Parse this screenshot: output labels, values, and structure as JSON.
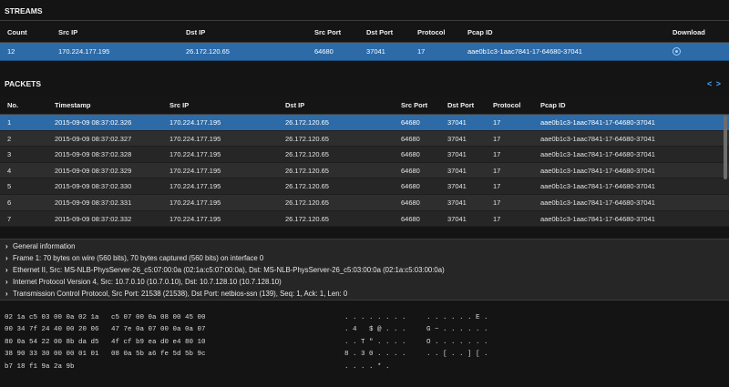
{
  "streams": {
    "title": "STREAMS",
    "headers": [
      "Count",
      "Src IP",
      "Dst IP",
      "Src Port",
      "Dst Port",
      "Protocol",
      "Pcap ID",
      "Download"
    ],
    "row": [
      "12",
      "170.224.177.195",
      "26.172.120.65",
      "64680",
      "37041",
      "17",
      "aae0b1c3-1aac7841-17-64680-37041"
    ],
    "download_icon": "download-circle-icon"
  },
  "packets": {
    "title": "PACKETS",
    "nav": "< >",
    "headers": [
      "No.",
      "Timestamp",
      "Src IP",
      "Dst IP",
      "Src Port",
      "Dst Port",
      "Protocol",
      "Pcap ID"
    ],
    "rows": [
      [
        "1",
        "2015-09-09 08:37:02.326",
        "170.224.177.195",
        "26.172.120.65",
        "64680",
        "37041",
        "17",
        "aae0b1c3-1aac7841-17-64680-37041"
      ],
      [
        "2",
        "2015-09-09 08:37:02.327",
        "170.224.177.195",
        "26.172.120.65",
        "64680",
        "37041",
        "17",
        "aae0b1c3-1aac7841-17-64680-37041"
      ],
      [
        "3",
        "2015-09-09 08:37:02.328",
        "170.224.177.195",
        "26.172.120.65",
        "64680",
        "37041",
        "17",
        "aae0b1c3-1aac7841-17-64680-37041"
      ],
      [
        "4",
        "2015-09-09 08:37:02.329",
        "170.224.177.195",
        "26.172.120.65",
        "64680",
        "37041",
        "17",
        "aae0b1c3-1aac7841-17-64680-37041"
      ],
      [
        "5",
        "2015-09-09 08:37:02.330",
        "170.224.177.195",
        "26.172.120.65",
        "64680",
        "37041",
        "17",
        "aae0b1c3-1aac7841-17-64680-37041"
      ],
      [
        "6",
        "2015-09-09 08:37:02.331",
        "170.224.177.195",
        "26.172.120.65",
        "64680",
        "37041",
        "17",
        "aae0b1c3-1aac7841-17-64680-37041"
      ],
      [
        "7",
        "2015-09-09 08:37:02.332",
        "170.224.177.195",
        "26.172.120.65",
        "64680",
        "37041",
        "17",
        "aae0b1c3-1aac7841-17-64680-37041"
      ]
    ]
  },
  "details": [
    "General information",
    "Frame 1: 70 bytes on wire (560 bits), 70 bytes captured (560 bits) on interface 0",
    "Ethernet II, Src: MS-NLB-PhysServer-26_c5:07:00:0a (02:1a:c5:07:00:0a), Dst: MS-NLB-PhysServer-26_c5:03:00:0a (02:1a:c5:03:00:0a)",
    "Internet Protocol Version 4, Src: 10.7.0.10 (10.7.0.10), Dst: 10.7.128.10 (10.7.128.10)",
    "Transmission Control Protocol, Src Port: 21538 (21538), Dst Port: netbios-ssn (139), Seq: 1, Ack: 1, Len: 0"
  ],
  "hex": [
    "02 1a c5 03 00 0a 02 1a   c5 07 00 0a 08 00 45 00",
    "00 34 7f 24 40 00 20 06   47 7e 0a 07 00 0a 0a 07",
    "80 0a 54 22 00 8b da d5   4f cf b9 ea d0 e4 80 10",
    "38 90 33 30 00 00 01 01   08 0a 5b a6 fe 5d 5b 9c",
    "b7 18 f1 9a 2a 9b"
  ],
  "ascii": [
    ". . . . . . . .     . . . . . . E .",
    ". 4   $ @ . . .     G ~ . . . . . .",
    ". . T \" . . . .     O . . . . . . .",
    "8 . 3 0 . . . .     . . [ . . ] [ .",
    ". . . . * ."
  ]
}
